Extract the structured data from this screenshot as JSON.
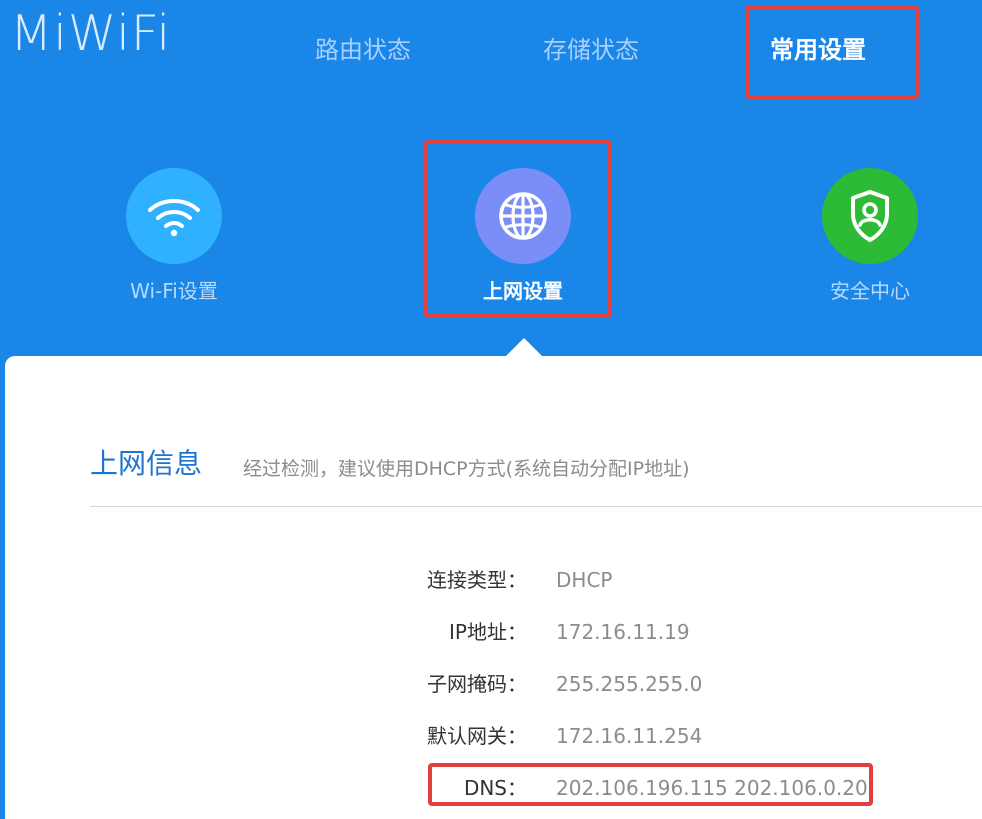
{
  "brand": {
    "logo_text": "MiWiFi"
  },
  "top_nav": {
    "items": [
      {
        "label": "路由状态"
      },
      {
        "label": "存储状态"
      },
      {
        "label": "常用设置"
      }
    ],
    "active_index": 2
  },
  "feature_nav": {
    "items": [
      {
        "label": "Wi-Fi设置",
        "icon": "wifi-icon",
        "color": "#30b1ff"
      },
      {
        "label": "上网设置",
        "icon": "globe-icon",
        "color": "#7b8ef8"
      },
      {
        "label": "安全中心",
        "icon": "shield-user-icon",
        "color": "#2dbb37"
      }
    ],
    "active_index": 1
  },
  "section": {
    "title": "上网信息",
    "description": "经过检测，建议使用DHCP方式(系统自动分配IP地址)"
  },
  "info_rows": [
    {
      "label": "连接类型：",
      "value": "DHCP"
    },
    {
      "label": "IP地址：",
      "value": "172.16.11.19"
    },
    {
      "label": "子网掩码：",
      "value": "255.255.255.0"
    },
    {
      "label": "默认网关：",
      "value": "172.16.11.254"
    },
    {
      "label": "DNS：",
      "value": "202.106.196.115 202.106.0.20"
    }
  ],
  "colors": {
    "header_background": "#1a86e8",
    "highlight": "#e43f3f",
    "section_title": "#1f73d2",
    "wifi_icon_bg": "#30b1ff",
    "network_icon_bg": "#7b8ef8",
    "security_icon_bg": "#2dbb37"
  }
}
